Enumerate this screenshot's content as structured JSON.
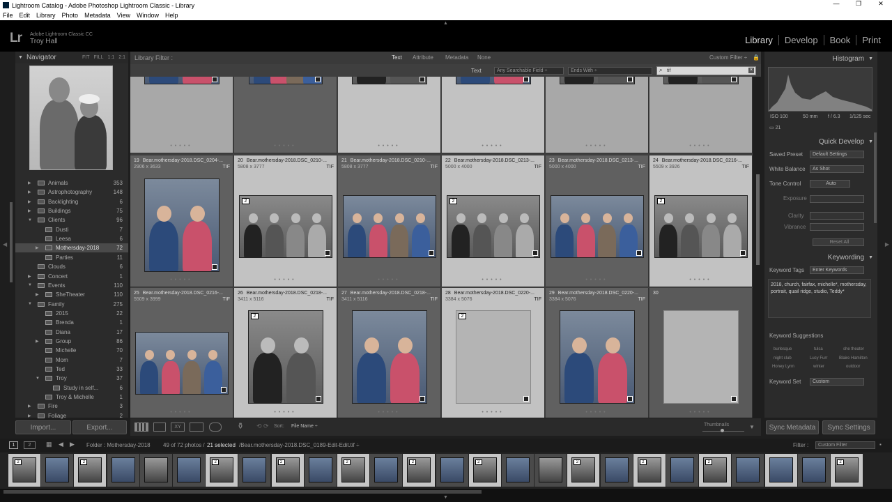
{
  "window": {
    "title": "Lightroom Catalog - Adobe Photoshop Lightroom Classic - Library",
    "controls": [
      "—",
      "❐",
      "✕"
    ]
  },
  "menu": [
    "File",
    "Edit",
    "Library",
    "Photo",
    "Metadata",
    "View",
    "Window",
    "Help"
  ],
  "identity": {
    "logo": "Lr",
    "product": "Adobe Lightroom Classic CC",
    "user": "Troy Hall"
  },
  "modules": [
    "Library",
    "Develop",
    "Book",
    "Print"
  ],
  "navigator": {
    "title": "Navigator",
    "zoom": [
      "FIT",
      "FILL",
      "1:1",
      "2:1"
    ]
  },
  "folders": [
    {
      "name": "Animals",
      "count": "353",
      "level": 1,
      "expanded": false
    },
    {
      "name": "Astrophotography",
      "count": "148",
      "level": 1,
      "expanded": false
    },
    {
      "name": "Backlighting",
      "count": "6",
      "level": 1,
      "expanded": false
    },
    {
      "name": "Buildings",
      "count": "75",
      "level": 1,
      "expanded": false
    },
    {
      "name": "Clients",
      "count": "96",
      "level": 1,
      "expanded": true
    },
    {
      "name": "Dusti",
      "count": "7",
      "level": 2,
      "expanded": null
    },
    {
      "name": "Leesa",
      "count": "6",
      "level": 2,
      "expanded": null
    },
    {
      "name": "Mothersday-2018",
      "count": "72",
      "level": 2,
      "expanded": false,
      "selected": true
    },
    {
      "name": "Parties",
      "count": "11",
      "level": 2,
      "expanded": null
    },
    {
      "name": "Clouds",
      "count": "6",
      "level": 1,
      "expanded": null
    },
    {
      "name": "Concert",
      "count": "1",
      "level": 1,
      "expanded": false
    },
    {
      "name": "Events",
      "count": "110",
      "level": 1,
      "expanded": true
    },
    {
      "name": "SheTheater",
      "count": "110",
      "level": 2,
      "expanded": false
    },
    {
      "name": "Family",
      "count": "275",
      "level": 1,
      "expanded": true
    },
    {
      "name": "2015",
      "count": "22",
      "level": 2,
      "expanded": null
    },
    {
      "name": "Brenda",
      "count": "1",
      "level": 2,
      "expanded": null
    },
    {
      "name": "Diana",
      "count": "17",
      "level": 2,
      "expanded": null
    },
    {
      "name": "Group",
      "count": "86",
      "level": 2,
      "expanded": false
    },
    {
      "name": "Michelle",
      "count": "70",
      "level": 2,
      "expanded": null
    },
    {
      "name": "Mom",
      "count": "7",
      "level": 2,
      "expanded": null
    },
    {
      "name": "Ted",
      "count": "33",
      "level": 2,
      "expanded": null
    },
    {
      "name": "Troy",
      "count": "37",
      "level": 2,
      "expanded": true
    },
    {
      "name": "Study in self...",
      "count": "6",
      "level": 3,
      "expanded": null
    },
    {
      "name": "Troy & Michelle",
      "count": "1",
      "level": 2,
      "expanded": null
    },
    {
      "name": "Fire",
      "count": "3",
      "level": 1,
      "expanded": false
    },
    {
      "name": "Foliage",
      "count": "2",
      "level": 1,
      "expanded": false
    }
  ],
  "left_buttons": {
    "import": "Import...",
    "export": "Export..."
  },
  "filter": {
    "label": "Library Filter :",
    "tabs": [
      "Text",
      "Attribute",
      "Metadata",
      "None"
    ],
    "custom": "Custom Filter ÷",
    "text_label": "Text",
    "field": "Any Searchable Field ÷",
    "rule": "Ends With ÷",
    "search_value": "tif"
  },
  "grid_rows": [
    [
      {
        "num": "",
        "name": "",
        "dims": "",
        "fmt": "",
        "tone": "mid",
        "badge": "",
        "bw": false
      },
      {
        "num": "",
        "name": "",
        "dims": "",
        "fmt": "",
        "tone": "dark",
        "badge": "",
        "bw": false
      },
      {
        "num": "",
        "name": "",
        "dims": "",
        "fmt": "",
        "tone": "light",
        "badge": "",
        "bw": true
      },
      {
        "num": "",
        "name": "",
        "dims": "",
        "fmt": "",
        "tone": "light",
        "badge": "",
        "bw": false
      },
      {
        "num": "",
        "name": "",
        "dims": "",
        "fmt": "",
        "tone": "mid",
        "badge": "",
        "bw": true
      },
      {
        "num": "",
        "name": "",
        "dims": "",
        "fmt": "",
        "tone": "mid",
        "badge": "",
        "bw": true
      }
    ],
    [
      {
        "num": "19",
        "name": "Bear.mothersday-2018.DSC_0204-...",
        "dims": "2906 x 3633",
        "fmt": "TIF",
        "tone": "dark",
        "badge": "",
        "bw": false
      },
      {
        "num": "20",
        "name": "Bear.mothersday-2018.DSC_0210-...",
        "dims": "5808 x 3777",
        "fmt": "TIF",
        "tone": "light",
        "badge": "2",
        "bw": true
      },
      {
        "num": "21",
        "name": "Bear.mothersday-2018.DSC_0210-...",
        "dims": "5808 x 3777",
        "fmt": "TIF",
        "tone": "dark",
        "badge": "",
        "bw": false
      },
      {
        "num": "22",
        "name": "Bear.mothersday-2018.DSC_0213-...",
        "dims": "5000 x 4000",
        "fmt": "TIF",
        "tone": "light",
        "badge": "2",
        "bw": true
      },
      {
        "num": "23",
        "name": "Bear.mothersday-2018.DSC_0213-...",
        "dims": "5000 x 4000",
        "fmt": "TIF",
        "tone": "dark",
        "badge": "",
        "bw": false
      },
      {
        "num": "24",
        "name": "Bear.mothersday-2018.DSC_0216-...",
        "dims": "5509 x 3926",
        "fmt": "TIF",
        "tone": "light",
        "badge": "2",
        "bw": true
      }
    ],
    [
      {
        "num": "25",
        "name": "Bear.mothersday-2018.DSC_0216-...",
        "dims": "5509 x 3999",
        "fmt": "TIF",
        "tone": "dark",
        "badge": "",
        "bw": false
      },
      {
        "num": "26",
        "name": "Bear.mothersday-2018.DSC_0218-...",
        "dims": "3411 x 5116",
        "fmt": "TIF",
        "tone": "light",
        "badge": "2",
        "bw": true
      },
      {
        "num": "27",
        "name": "Bear.mothersday-2018.DSC_0218-...",
        "dims": "3411 x 5116",
        "fmt": "TIF",
        "tone": "dark",
        "badge": "",
        "bw": false
      },
      {
        "num": "28",
        "name": "Bear.mothersday-2018.DSC_0220-...",
        "dims": "3384 x 5076",
        "fmt": "TIF",
        "tone": "light",
        "badge": "2",
        "bw": "blank"
      },
      {
        "num": "29",
        "name": "Bear.mothersday-2018.DSC_0220-...",
        "dims": "3384 x 5076",
        "fmt": "TIF",
        "tone": "dark",
        "badge": "",
        "bw": false
      },
      {
        "num": "30",
        "name": "",
        "dims": "",
        "fmt": "",
        "tone": "dark2",
        "badge": "",
        "bw": "blank"
      }
    ]
  ],
  "toolbar": {
    "sort_label": "Sort:",
    "sort_value": "File Name ÷",
    "thumbs_label": "Thumbnails"
  },
  "histogram": {
    "title": "Histogram",
    "iso": "ISO 100",
    "focal": "50 mm",
    "aperture": "f / 6.3",
    "shutter": "1/125 sec",
    "count": "21"
  },
  "quick_develop": {
    "title": "Quick Develop",
    "saved_preset_label": "Saved Preset",
    "saved_preset_value": "Default Settings",
    "wb_label": "White Balance",
    "wb_value": "As Shot",
    "tone_label": "Tone Control",
    "auto": "Auto",
    "exposure": "Exposure",
    "clarity": "Clarity",
    "vibrance": "Vibrance",
    "reset": "Reset All"
  },
  "keywording": {
    "title": "Keywording",
    "tags_label": "Keyword Tags",
    "tags_mode": "Enter Keywords",
    "tags": "2018, church, fairfax, michelle*, mothersday, portrait, quail ridge, studio, Teddy*",
    "suggestions_label": "Keyword Suggestions",
    "suggestions": [
      "burlesque",
      "tulsa",
      "she theater",
      "night club",
      "Lucy Furr",
      "Blaire Hamilton",
      "Honey Lynn",
      "winter",
      "outdoor"
    ],
    "set_label": "Keyword Set",
    "set_value": "Custom"
  },
  "right_buttons": {
    "sync_meta": "Sync Metadata",
    "sync_settings": "Sync Settings"
  },
  "filmbar": {
    "page1": "1",
    "page2": "2",
    "folder": "Folder : Mothersday-2018",
    "count": "49 of 72 photos /",
    "selected": "21 selected",
    "file": "/Bear.mothersday-2018.DSC_0189-Edit-Edit.tif ÷",
    "filter_label": "Filter :",
    "filter_value": "Custom Filter"
  },
  "film_thumbs": [
    {
      "badge": "2",
      "bw": true,
      "light": true
    },
    {
      "badge": "",
      "bw": false,
      "light": false
    },
    {
      "badge": "2",
      "bw": true,
      "light": true
    },
    {
      "badge": "",
      "bw": false,
      "light": false
    },
    {
      "badge": "",
      "bw": true,
      "light": false
    },
    {
      "badge": "",
      "bw": false,
      "light": false
    },
    {
      "badge": "2",
      "bw": true,
      "light": true
    },
    {
      "badge": "",
      "bw": false,
      "light": false
    },
    {
      "badge": "2",
      "bw": true,
      "light": true
    },
    {
      "badge": "",
      "bw": false,
      "light": false
    },
    {
      "badge": "2",
      "bw": true,
      "light": true
    },
    {
      "badge": "",
      "bw": false,
      "light": false
    },
    {
      "badge": "2",
      "bw": true,
      "light": true
    },
    {
      "badge": "",
      "bw": false,
      "light": false
    },
    {
      "badge": "2",
      "bw": true,
      "light": true
    },
    {
      "badge": "",
      "bw": false,
      "light": false
    },
    {
      "badge": "",
      "bw": true,
      "light": false
    },
    {
      "badge": "2",
      "bw": true,
      "light": true
    },
    {
      "badge": "",
      "bw": false,
      "light": false
    },
    {
      "badge": "2",
      "bw": true,
      "light": true
    },
    {
      "badge": "",
      "bw": false,
      "light": false
    },
    {
      "badge": "2",
      "bw": true,
      "light": true
    },
    {
      "badge": "",
      "bw": false,
      "light": false
    },
    {
      "badge": "",
      "bw": false,
      "light": true
    },
    {
      "badge": "",
      "bw": false,
      "light": false
    },
    {
      "badge": "2",
      "bw": true,
      "light": true
    }
  ]
}
